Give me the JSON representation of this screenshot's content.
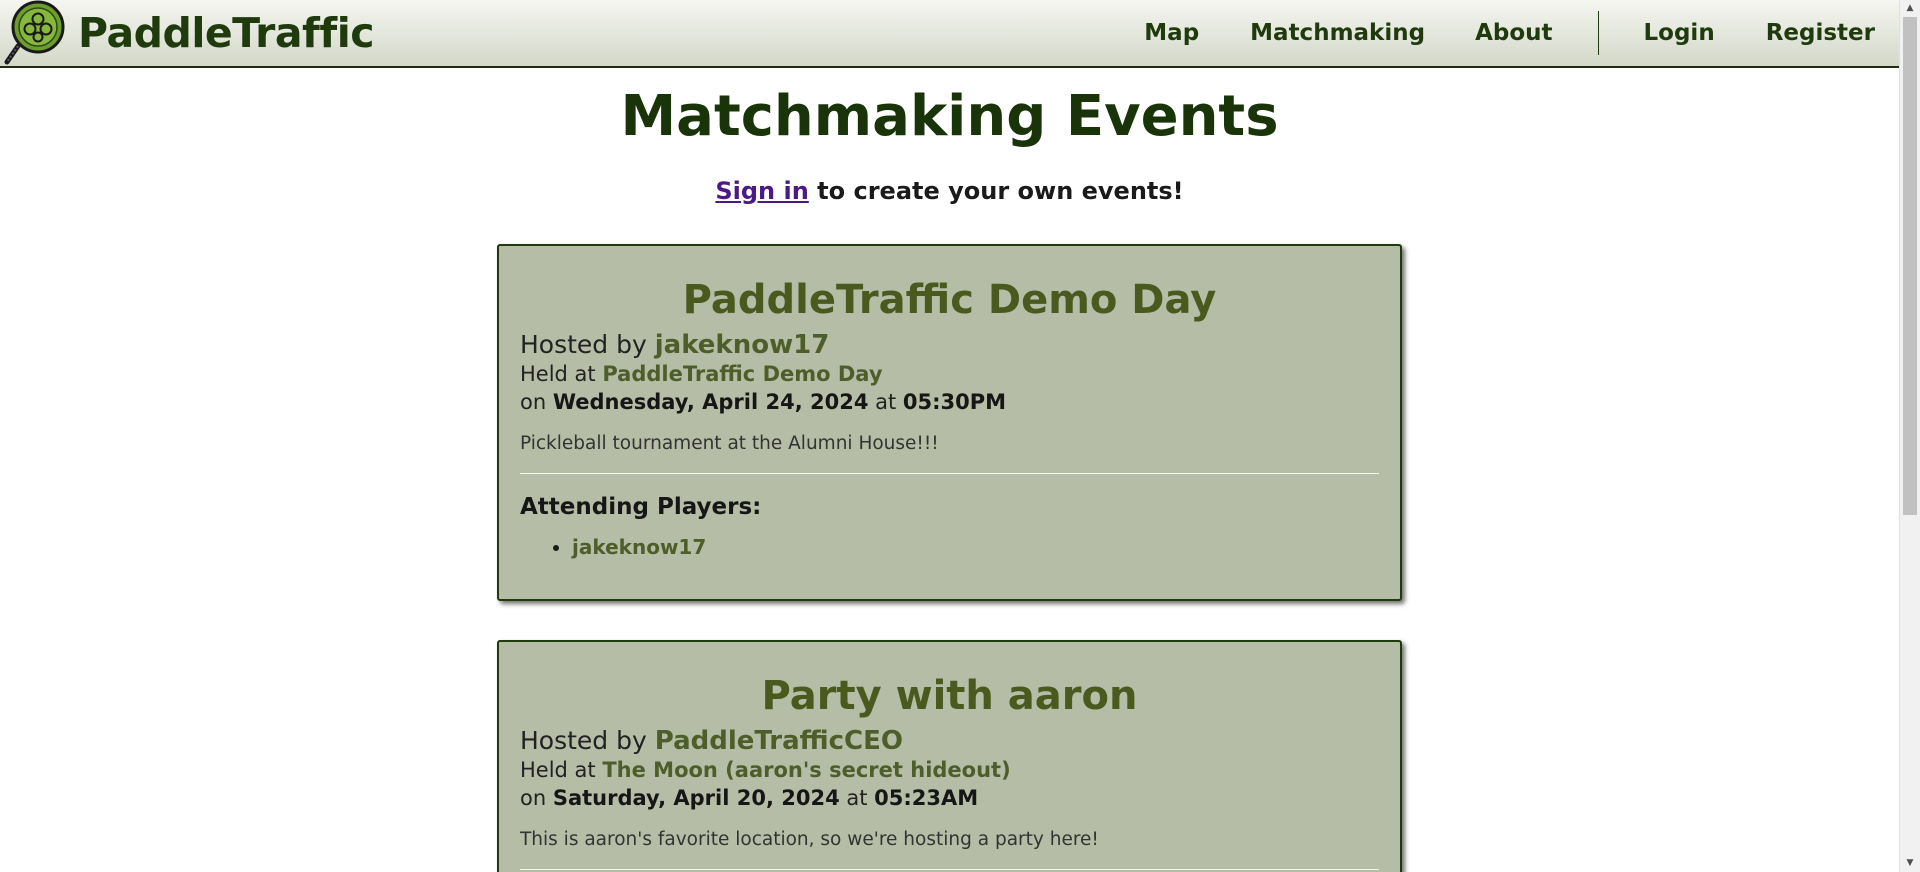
{
  "brand": {
    "name": "PaddleTraffic",
    "logo_icon": "pickleball-paddle-icon"
  },
  "nav": {
    "map": "Map",
    "matchmaking": "Matchmaking",
    "about": "About",
    "login": "Login",
    "register": "Register"
  },
  "page": {
    "title": "Matchmaking Events",
    "signin_link": "Sign in",
    "signin_suffix": " to create your own events!"
  },
  "labels": {
    "hosted_by": "Hosted by ",
    "held_at": "Held at ",
    "on": "on ",
    "at": " at ",
    "attending_players": "Attending Players:"
  },
  "events": [
    {
      "title": "PaddleTraffic Demo Day",
      "host": "jakeknow17",
      "location": "PaddleTraffic Demo Day",
      "date": "Wednesday, April 24, 2024",
      "time": "05:30PM",
      "description": "Pickleball tournament at the Alumni House!!!",
      "players": [
        "jakeknow17"
      ]
    },
    {
      "title": "Party with aaron",
      "host": "PaddleTrafficCEO",
      "location": "The Moon (aaron's secret hideout)",
      "date": "Saturday, April 20, 2024",
      "time": "05:23AM",
      "description": "This is aaron's favorite location, so we're hosting a party here!",
      "players": []
    }
  ],
  "colors": {
    "brand_green": "#1f3a0c",
    "card_bg": "#b5bda6",
    "link_green": "#4e5e2a",
    "signin_link": "#4b1a87"
  }
}
